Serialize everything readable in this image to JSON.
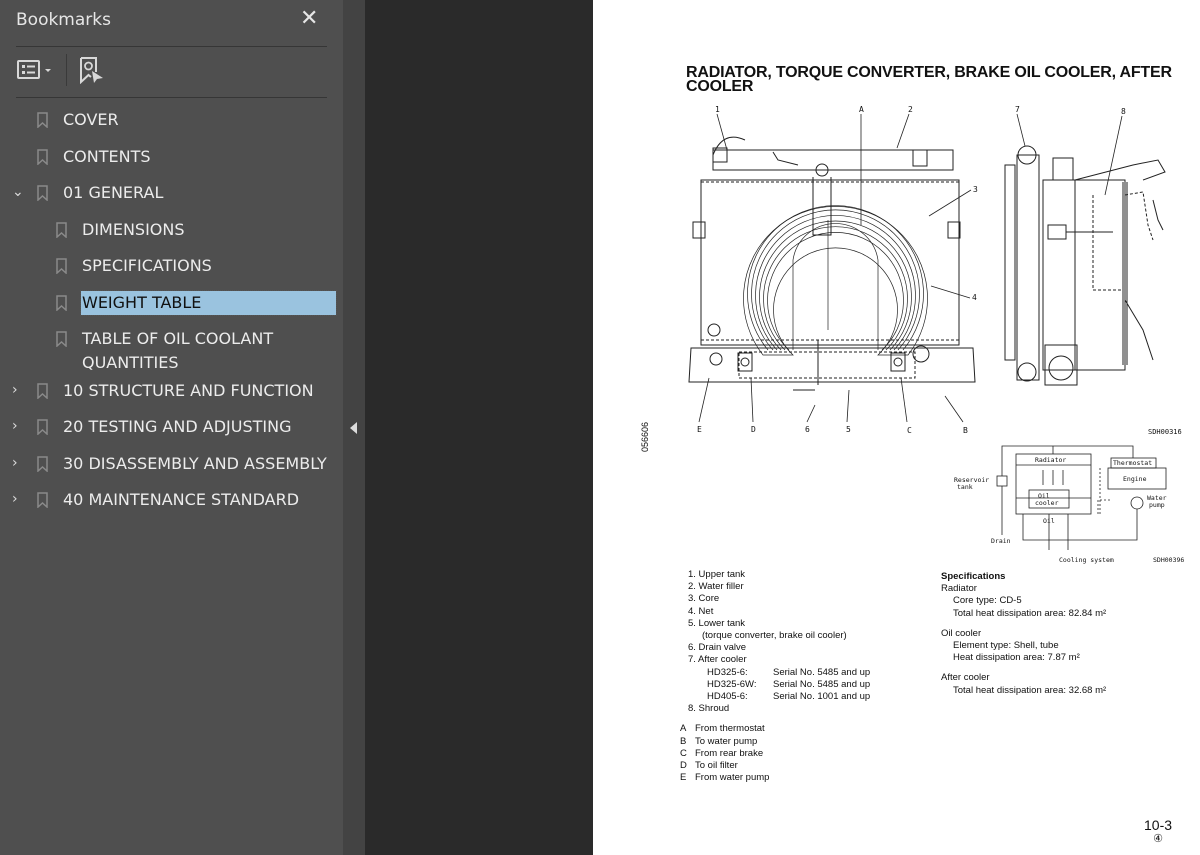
{
  "sidebar": {
    "title": "Bookmarks",
    "close_icon": "close-icon",
    "toolbar": {
      "options_icon": "list-options-icon",
      "find_bookmark_icon": "find-current-bookmark-icon"
    },
    "items": [
      {
        "label": "COVER",
        "level": 0,
        "expander": "none"
      },
      {
        "label": "CONTENTS",
        "level": 0,
        "expander": "none"
      },
      {
        "label": "01 GENERAL",
        "level": 0,
        "expander": "expanded"
      },
      {
        "label": "DIMENSIONS",
        "level": 1,
        "expander": "none"
      },
      {
        "label": "SPECIFICATIONS",
        "level": 1,
        "expander": "none"
      },
      {
        "label": "WEIGHT TABLE",
        "level": 1,
        "expander": "none",
        "selected": true
      },
      {
        "label": "TABLE OF OIL COOLANT",
        "label_line2": "QUANTITIES",
        "level": 1,
        "expander": "none"
      },
      {
        "label": "10 STRUCTURE AND FUNCTION",
        "level": 0,
        "expander": "collapsed"
      },
      {
        "label": "20 TESTING AND ADJUSTING",
        "level": 0,
        "expander": "collapsed"
      },
      {
        "label": "30 DISASSEMBLY AND ASSEMBLY",
        "level": 0,
        "expander": "collapsed"
      },
      {
        "label": "40 MAINTENANCE STANDARD",
        "level": 0,
        "expander": "collapsed"
      }
    ],
    "selected_color": "#9ac3df"
  },
  "splitter": {
    "collapse_icon": "collapse-left-icon"
  },
  "document": {
    "title_line1": "RADIATOR, TORQUE CONVERTER, BRAKE OIL COOLER, AFTER",
    "title_line2": "COOLER",
    "side_code": "056606",
    "figure": {
      "callouts_top": [
        "1",
        "A",
        "2",
        "7",
        "8"
      ],
      "callouts_right": [
        "3",
        "4"
      ],
      "callouts_bottom": [
        "E",
        "D",
        "6",
        "5",
        "C",
        "B"
      ],
      "figure_code": "SDH00316",
      "schematic": {
        "labels": [
          "Radiator",
          "Thermostat",
          "Engine",
          "Reservoir tank",
          "Make-up bypass",
          "Oil cooler",
          "Oil",
          "Water pump",
          "Drain"
        ],
        "caption": "Cooling system",
        "code": "SDH00396"
      }
    },
    "legend_numbered": [
      "1. Upper tank",
      "2. Water filler",
      "3. Core",
      "4. Net",
      "5. Lower tank",
      "(torque converter, brake oil cooler)",
      "6. Drain valve",
      "7. After cooler",
      "8. Shroud"
    ],
    "after_cooler_serials": [
      {
        "model": "HD325-6:",
        "serial": "Serial No. 5485 and up"
      },
      {
        "model": "HD325-6W:",
        "serial": "Serial No. 5485 and up"
      },
      {
        "model": "HD405-6:",
        "serial": "Serial No. 1001 and up"
      }
    ],
    "legend_letters": [
      {
        "key": "A",
        "text": "From thermostat"
      },
      {
        "key": "B",
        "text": "To water pump"
      },
      {
        "key": "C",
        "text": "From rear brake"
      },
      {
        "key": "D",
        "text": "To oil filter"
      },
      {
        "key": "E",
        "text": "From water pump"
      }
    ],
    "specs": {
      "heading": "Specifications",
      "radiator": {
        "label": "Radiator",
        "core_type": "Core type:  CD-5",
        "area": "Total heat dissipation area:  82.84 m²"
      },
      "oil_cooler": {
        "label": "Oil cooler",
        "element_type": "Element type:  Shell, tube",
        "area": "Heat dissipation area:  7.87 m²"
      },
      "after_cooler": {
        "label": "After cooler",
        "area": "Total heat dissipation area:  32.68 m²"
      }
    },
    "page_number": "10-3",
    "revision": "④"
  }
}
